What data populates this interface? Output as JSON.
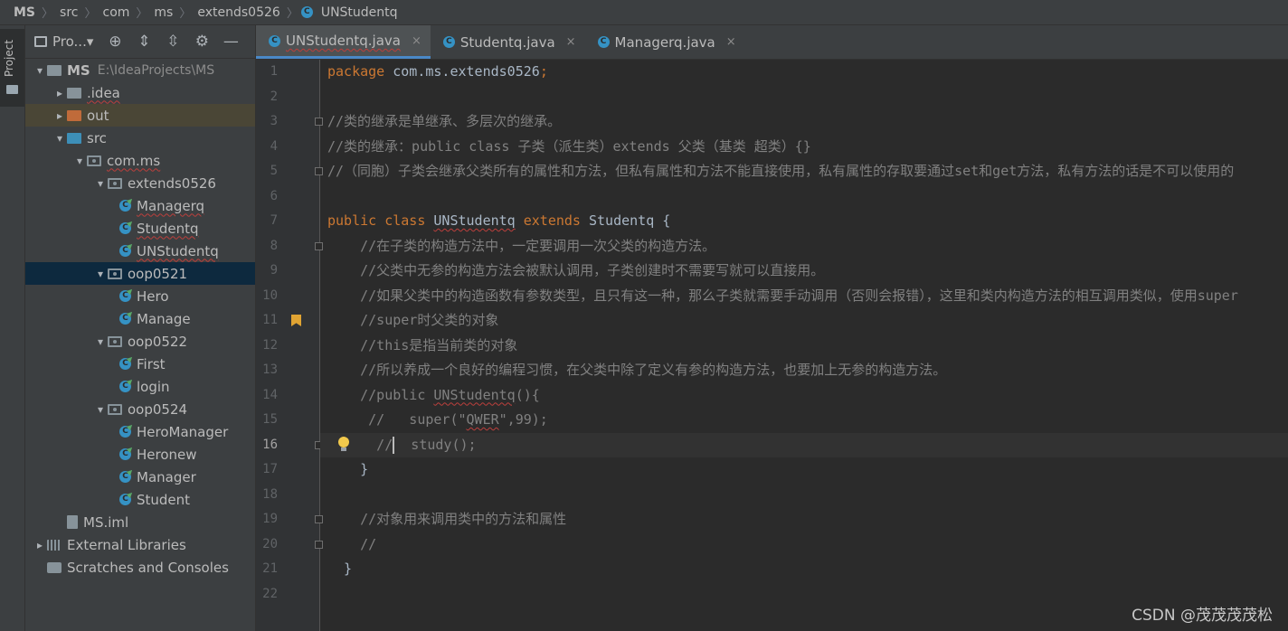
{
  "breadcrumb": [
    "MS",
    "src",
    "com",
    "ms",
    "extends0526",
    "UNStudentq"
  ],
  "side_tab": "Project",
  "panel": {
    "title": "Pro...",
    "dropdown": "▾"
  },
  "tree": [
    {
      "indent": 0,
      "arrow": "▾",
      "icon": "folder-module",
      "label": "MS",
      "path": "E:\\IdeaProjects\\MS",
      "bold": true
    },
    {
      "indent": 1,
      "arrow": "▸",
      "icon": "folder",
      "label": ".idea",
      "wavy": true
    },
    {
      "indent": 1,
      "arrow": "▸",
      "icon": "folder-orange",
      "label": "out",
      "highlight": true
    },
    {
      "indent": 1,
      "arrow": "▾",
      "icon": "folder-blue",
      "label": "src"
    },
    {
      "indent": 2,
      "arrow": "▾",
      "icon": "package",
      "label": "com.ms",
      "wavy": true
    },
    {
      "indent": 3,
      "arrow": "▾",
      "icon": "package",
      "label": "extends0526"
    },
    {
      "indent": 4,
      "arrow": "",
      "icon": "class",
      "label": "Managerq",
      "wavy": true
    },
    {
      "indent": 4,
      "arrow": "",
      "icon": "class",
      "label": "Studentq",
      "wavy": true
    },
    {
      "indent": 4,
      "arrow": "",
      "icon": "class",
      "label": "UNStudentq",
      "wavy": true
    },
    {
      "indent": 3,
      "arrow": "▾",
      "icon": "package",
      "label": "oop0521",
      "selected": true
    },
    {
      "indent": 4,
      "arrow": "",
      "icon": "class",
      "label": "Hero"
    },
    {
      "indent": 4,
      "arrow": "",
      "icon": "class",
      "label": "Manage"
    },
    {
      "indent": 3,
      "arrow": "▾",
      "icon": "package",
      "label": "oop0522"
    },
    {
      "indent": 4,
      "arrow": "",
      "icon": "class",
      "label": "First"
    },
    {
      "indent": 4,
      "arrow": "",
      "icon": "class",
      "label": "login"
    },
    {
      "indent": 3,
      "arrow": "▾",
      "icon": "package",
      "label": "oop0524"
    },
    {
      "indent": 4,
      "arrow": "",
      "icon": "class",
      "label": "HeroManager"
    },
    {
      "indent": 4,
      "arrow": "",
      "icon": "class",
      "label": "Heronew"
    },
    {
      "indent": 4,
      "arrow": "",
      "icon": "class",
      "label": "Manager"
    },
    {
      "indent": 4,
      "arrow": "",
      "icon": "class",
      "label": "Student"
    },
    {
      "indent": 1,
      "arrow": "",
      "icon": "iml-file",
      "label": "MS.iml"
    },
    {
      "indent": 0,
      "arrow": "▸",
      "icon": "libraries",
      "label": "External Libraries"
    },
    {
      "indent": 0,
      "arrow": "",
      "icon": "scratches",
      "label": "Scratches and Consoles"
    }
  ],
  "tabs": [
    {
      "label": "UNStudentq.java",
      "active": true,
      "close": "×"
    },
    {
      "label": "Studentq.java",
      "active": false,
      "close": "×"
    },
    {
      "label": "Managerq.java",
      "active": false,
      "close": "×"
    }
  ],
  "current_line": 16,
  "code_lines": [
    [
      [
        "kw",
        "package "
      ],
      [
        "",
        "com.ms.extends0526"
      ],
      [
        "kw",
        ";"
      ]
    ],
    [],
    [
      [
        "cm",
        "//类的继承是单继承、多层次的继承。"
      ]
    ],
    [
      [
        "cm",
        "//类的继承：public class 子类（派生类）extends 父类（基类 超类）{}"
      ]
    ],
    [
      [
        "cm",
        "//（同胞）子类会继承父类所有的属性和方法，但私有属性和方法不能直接使用，私有属性的存取要通过set和get方法，私有方法的话是不可以使用的"
      ]
    ],
    [],
    [
      [
        "kw",
        "public class "
      ],
      [
        "wavy",
        "UNStudentq"
      ],
      [
        "kw",
        " extends "
      ],
      [
        "",
        "Studentq {"
      ]
    ],
    [
      [
        "cm",
        "    //在子类的构造方法中，一定要调用一次父类的构造方法。"
      ]
    ],
    [
      [
        "cm",
        "    //父类中无参的构造方法会被默认调用，子类创建时不需要写就可以直接用。"
      ]
    ],
    [
      [
        "cm",
        "    //如果父类中的构造函数有参数类型，且只有这一种，那么子类就需要手动调用（否则会报错），这里和类内构造方法的相互调用类似，使用super"
      ]
    ],
    [
      [
        "cm",
        "    //super时父类的对象"
      ]
    ],
    [
      [
        "cm",
        "    //this是指当前类的对象"
      ]
    ],
    [
      [
        "cm",
        "    //所以养成一个良好的编程习惯，在父类中除了定义有参的构造方法，也要加上无参的构造方法。"
      ]
    ],
    [
      [
        "cm",
        "    //public "
      ],
      [
        "cmwavy",
        "UNStudentq"
      ],
      [
        "cm",
        "(){"
      ]
    ],
    [
      [
        "cm",
        "     //   super(\""
      ],
      [
        "cmwavy",
        "QWER"
      ],
      [
        "cm",
        "\",99);"
      ]
    ],
    [
      [
        "cm",
        "      //"
      ],
      [
        "caret",
        ""
      ],
      [
        "cm",
        "  study();"
      ]
    ],
    [
      [
        "",
        "    }"
      ]
    ],
    [],
    [
      [
        "cm",
        "    //对象用来调用类中的方法和属性"
      ]
    ],
    [
      [
        "cm",
        "    //"
      ]
    ],
    [
      [
        "",
        "  }"
      ]
    ],
    []
  ],
  "fold_lines": [
    3,
    5,
    8,
    16,
    19,
    20
  ],
  "bookmark_lines": [
    11
  ],
  "bulb_lines": [
    16
  ],
  "watermark": "CSDN @茂茂茂茂松"
}
